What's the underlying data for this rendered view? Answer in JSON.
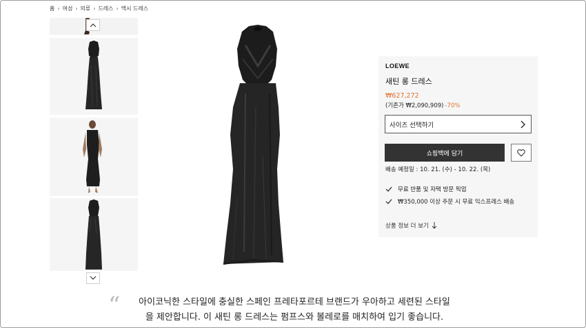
{
  "breadcrumb": [
    "홈",
    "여성",
    "의류",
    "드레스",
    "맥시 드레스"
  ],
  "product": {
    "brand": "LOEWE",
    "name": "새틴 롱 드레스",
    "price": "₩627,272",
    "original_price": "(기존가 ₩2,090,909)",
    "discount": "-70%"
  },
  "size_select_label": "사이즈 선택하기",
  "add_to_bag_label": "쇼핑백에 담기",
  "delivery_estimate": "배송 예정일 : 10. 21. (수) - 10. 22. (목)",
  "benefits": [
    "무료 반품 및 자택 방문 픽업",
    "₩350,000 이상 주문 시 무료 익스프레스 배송"
  ],
  "more_info_label": "상품 정보 더 보기",
  "quote_text": "아이코닉한 스타일에 충실한 스페인 프레타포르테 브랜드가 우아하고 세련된 스타일을 제안합니다. 이 새틴 롱 드레스는 펌프스와 볼레로를 매치하여 입기 좋습니다.",
  "colors": {
    "accent": "#e4712e",
    "button": "#333333",
    "panel_bg": "#f6f6f6"
  },
  "icons": [
    "chevron-up-icon",
    "chevron-down-icon",
    "chevron-right-icon",
    "heart-icon",
    "check-icon",
    "arrow-down-icon"
  ]
}
